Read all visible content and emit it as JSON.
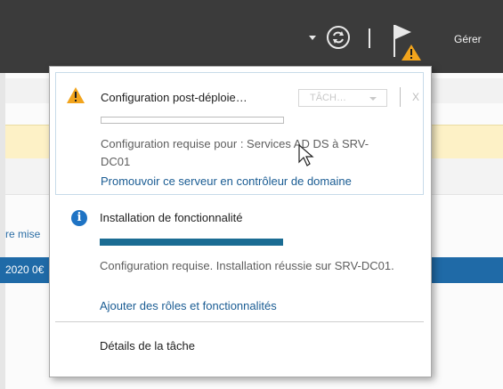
{
  "header": {
    "manage_label": "Gérer",
    "icons": [
      "dropdown-arrow-icon",
      "refresh-icon",
      "flag-warning-icon"
    ]
  },
  "background": {
    "partial_text_left": "re mise",
    "partial_row_text": "2020 0€"
  },
  "notifications": {
    "items": [
      {
        "icon": "warning-icon",
        "title": "Configuration post-déploie…",
        "task_button": "TÂCH…",
        "close": "X",
        "progress": 0,
        "description": "Configuration requise pour : Services AD DS à SRV-DC01",
        "link": "Promouvoir ce serveur en contrôleur de domaine"
      },
      {
        "icon": "info-icon",
        "title": "Installation de fonctionnalité",
        "progress": 1.0,
        "description": "Configuration requise. Installation réussie sur SRV-DC01.",
        "link": "Ajouter des rôles et fonctionnalités"
      }
    ],
    "footer_link": "Détails de la tâche"
  },
  "colors": {
    "topbar": "#3b3b3b",
    "link": "#1a5c93",
    "progress_fill": "#1b6c93",
    "warning": "#f2a41c",
    "info": "#1e73c4",
    "selected_row": "#1f6aa7"
  }
}
